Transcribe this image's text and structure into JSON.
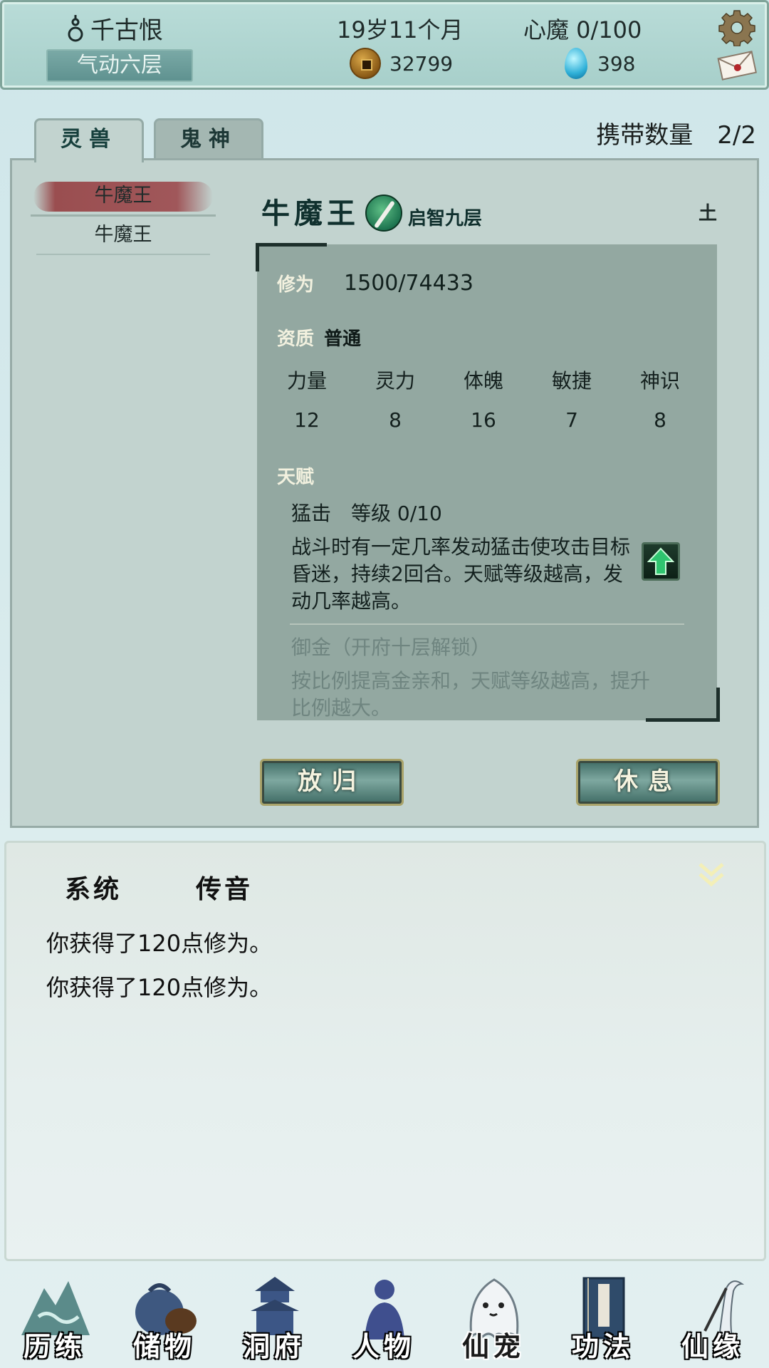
{
  "top_bar": {
    "player_name": "千古恨",
    "realm": "气动六层",
    "age": "19岁11个月",
    "heart_demon": "心魔  0/100",
    "coins": "32799",
    "gems": "398"
  },
  "tabs": [
    {
      "label": "灵兽"
    },
    {
      "label": "鬼神"
    }
  ],
  "carry": {
    "label": "携带数量",
    "value": "2/2"
  },
  "beast_list": [
    {
      "name": "牛魔王",
      "selected": true
    },
    {
      "name": "牛魔王",
      "selected": false
    }
  ],
  "pet": {
    "name": "牛魔王",
    "level": "启智九层",
    "element": "土",
    "cultivation_label": "修为",
    "cultivation_value": "1500/74433",
    "aptitude_label": "资质",
    "aptitude_value": "普通",
    "stat_labels": [
      "力量",
      "灵力",
      "体魄",
      "敏捷",
      "神识"
    ],
    "stat_values": [
      "12",
      "8",
      "16",
      "7",
      "8"
    ],
    "talent_label": "天赋",
    "talent1_name": "猛击",
    "talent1_level": "等级  0/10",
    "talent1_desc": "战斗时有一定几率发动猛击使攻击目标昏迷，持续2回合。天赋等级越高，发动几率越高。",
    "talent2_name": "御金（开府十层解锁）",
    "talent2_desc": "按比例提高金亲和，天赋等级越高，提升比例越大。"
  },
  "actions": {
    "release": "放归",
    "rest": "休息"
  },
  "messages": {
    "tab_system": "系统",
    "tab_transmit": "传音",
    "lines": [
      "你获得了120点修为。",
      "你获得了120点修为。"
    ]
  },
  "bottom_nav": [
    {
      "label": "历练",
      "icon": "mountain-icon"
    },
    {
      "label": "储物",
      "icon": "bag-icon"
    },
    {
      "label": "洞府",
      "icon": "pagoda-icon"
    },
    {
      "label": "人物",
      "icon": "person-icon"
    },
    {
      "label": "仙宠",
      "icon": "ghost-pet-icon"
    },
    {
      "label": "功法",
      "icon": "book-icon"
    },
    {
      "label": "仙缘",
      "icon": "crane-icon"
    }
  ],
  "active_nav": "仙宠"
}
